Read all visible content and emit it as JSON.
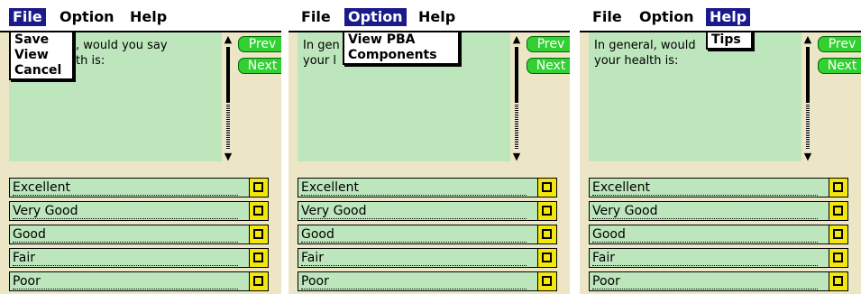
{
  "menus": [
    "File",
    "Option",
    "Help"
  ],
  "file_menu_items": [
    "Save",
    "View",
    "Cancel"
  ],
  "option_menu_items": [
    "View PBA",
    "Components"
  ],
  "help_menu_items": [
    "Tips"
  ],
  "screens": [
    {
      "active_menu": "File",
      "question_visible": ", would you say\nth is:"
    },
    {
      "active_menu": "Option",
      "question_visible": "In gen             uy\nyour l"
    },
    {
      "active_menu": "Help",
      "question_visible": "In general, would         y\nyour health is:"
    }
  ],
  "buttons": {
    "prev": "Prev",
    "next": "Next"
  },
  "answers": [
    "Excellent",
    "Very Good",
    "Good",
    "Fair",
    "Poor"
  ],
  "colors": {
    "menu_highlight": "#1a1a8a",
    "question_bg": "#bde6bd",
    "button_green": "#33d033",
    "checkbox_yellow": "#f2e60a",
    "background": "#ece6c6"
  }
}
